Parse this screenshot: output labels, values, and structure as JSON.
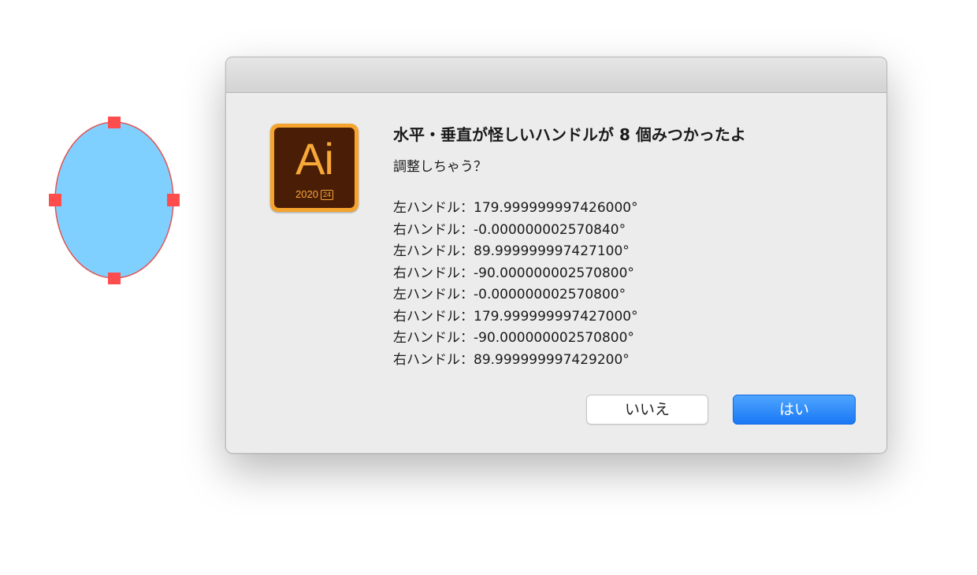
{
  "dialog": {
    "app_icon": {
      "letters": "Ai",
      "year": "2020",
      "version_badge": "24",
      "icon_name": "adobe-illustrator-icon"
    },
    "title": "水平・垂直が怪しいハンドルが 8 個みつかったよ",
    "question": "調整しちゃう？",
    "handles": [
      "左ハンドル：179.999999997426000°",
      "右ハンドル：-0.000000002570840°",
      "左ハンドル：89.999999997427100°",
      "右ハンドル：-90.000000002570800°",
      "左ハンドル：-0.000000002570800°",
      "右ハンドル：179.999999997427000°",
      "左ハンドル：-90.000000002570800°",
      "右ハンドル：89.999999997429200°"
    ],
    "buttons": {
      "no": "いいえ",
      "yes": "はい"
    }
  },
  "colors": {
    "shape_fill": "#80d0ff",
    "shape_stroke": "#e05555",
    "anchor": "#ff4d4d",
    "accent_button": "#1a78f4"
  }
}
